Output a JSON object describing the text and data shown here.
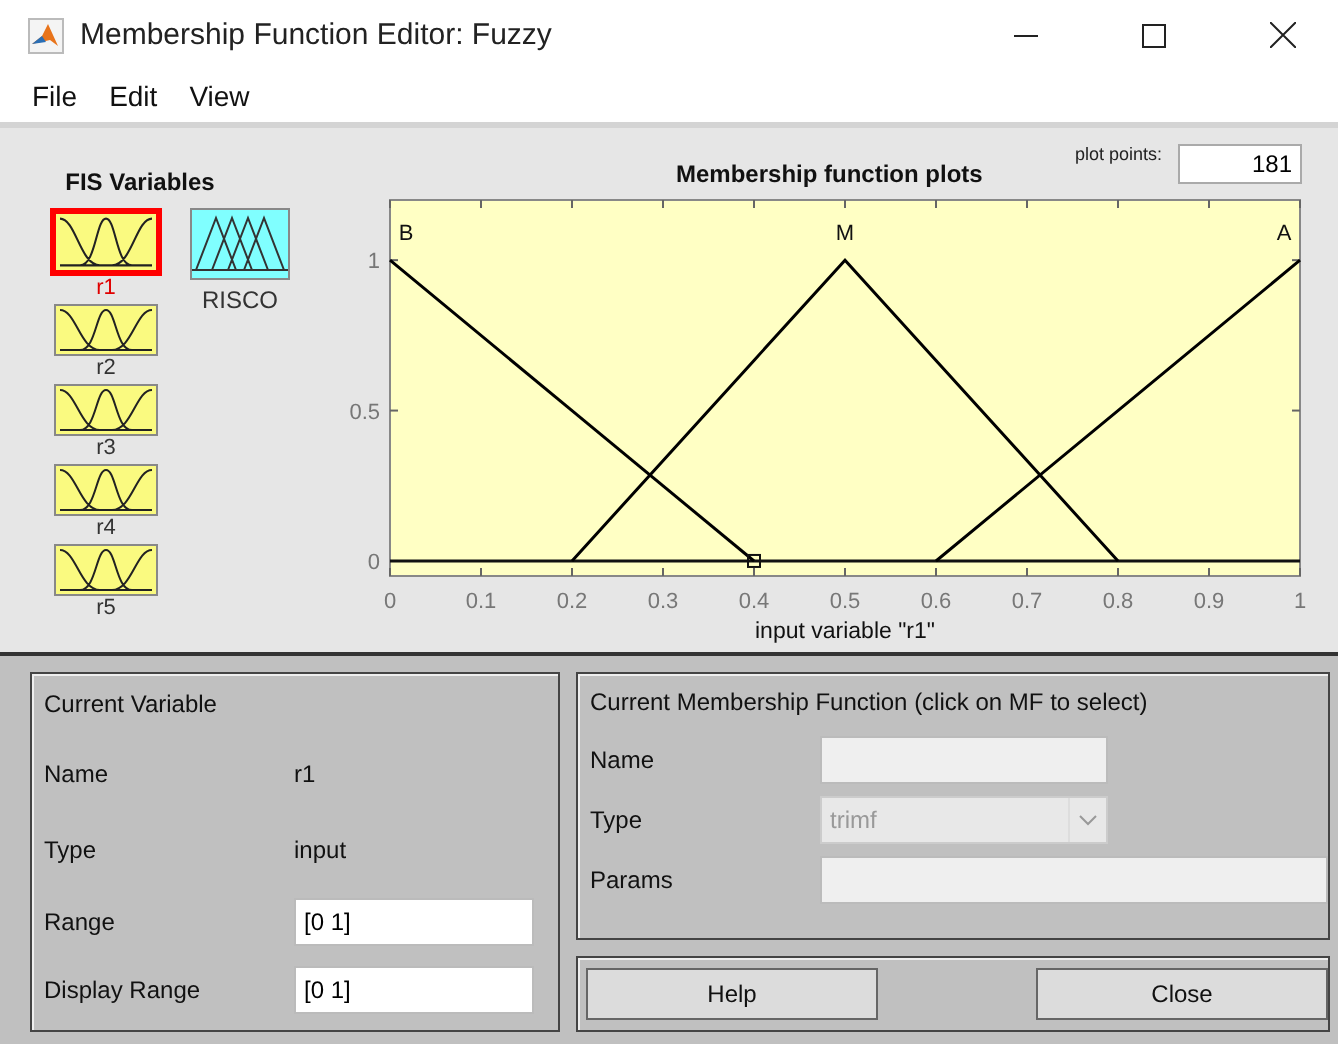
{
  "window": {
    "title": "Membership Function Editor: Fuzzy"
  },
  "menu": [
    {
      "label": "File"
    },
    {
      "label": "Edit"
    },
    {
      "label": "View"
    }
  ],
  "fis_variables": {
    "title": "FIS Variables",
    "items": [
      {
        "name": "r1",
        "kind": "input",
        "selected": true
      },
      {
        "name": "r2",
        "kind": "input",
        "selected": false
      },
      {
        "name": "r3",
        "kind": "input",
        "selected": false
      },
      {
        "name": "r4",
        "kind": "input",
        "selected": false
      },
      {
        "name": "r5",
        "kind": "input",
        "selected": false
      },
      {
        "name": "RISCO",
        "kind": "output",
        "selected": false
      }
    ]
  },
  "plot": {
    "title": "Membership function plots",
    "plot_points_label": "plot points:",
    "plot_points": "181",
    "chart_data": {
      "type": "line",
      "xlabel": "input variable \"r1\"",
      "x": [
        0,
        0.2,
        0.4,
        0.5,
        0.6,
        0.8,
        1
      ],
      "series": [
        {
          "name": "B",
          "color": "#000000",
          "values": [
            1,
            0.5,
            0,
            null,
            null,
            null,
            null
          ]
        },
        {
          "name": "M",
          "color": "#000000",
          "values": [
            null,
            0,
            0.667,
            1,
            0.667,
            0,
            null
          ]
        },
        {
          "name": "A",
          "color": "#000000",
          "values": [
            null,
            null,
            null,
            null,
            0,
            0.5,
            1
          ]
        }
      ],
      "xlim": [
        0,
        1
      ],
      "ylim": [
        -0.05,
        1.2
      ],
      "xticks": [
        0,
        0.1,
        0.2,
        0.3,
        0.4,
        0.5,
        0.6,
        0.7,
        0.8,
        0.9,
        1
      ],
      "yticks": [
        0,
        0.5,
        1
      ]
    }
  },
  "current_variable": {
    "title": "Current Variable",
    "name_label": "Name",
    "name": "r1",
    "type_label": "Type",
    "type": "input",
    "range_label": "Range",
    "range": "[0 1]",
    "display_range_label": "Display Range",
    "display_range": "[0 1]"
  },
  "current_mf": {
    "title": "Current Membership Function (click on MF to select)",
    "name_label": "Name",
    "type_label": "Type",
    "type": "trimf",
    "params_label": "Params",
    "disabled": true
  },
  "buttons": [
    {
      "label": "Help"
    },
    {
      "label": "Close"
    }
  ]
}
